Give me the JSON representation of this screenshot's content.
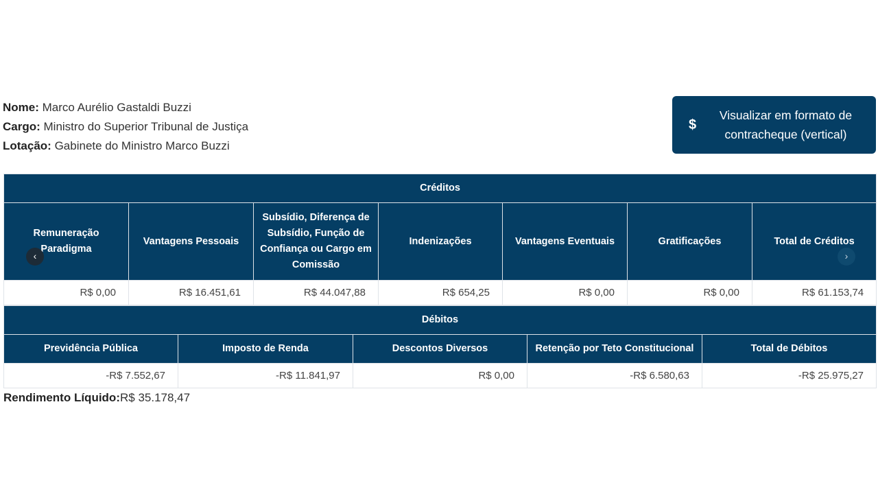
{
  "info": {
    "nome_label": "Nome:",
    "nome_value": "Marco Aurélio Gastaldi Buzzi",
    "cargo_label": "Cargo:",
    "cargo_value": "Ministro do Superior Tribunal de Justiça",
    "lotacao_label": "Lotação:",
    "lotacao_value": "Gabinete do Ministro Marco Buzzi"
  },
  "view_button": {
    "icon": "$",
    "icon_name": "dollar-icon",
    "label": "Visualizar em formato de contracheque (vertical)"
  },
  "creditos": {
    "title": "Créditos",
    "columns": [
      "Remuneração Paradigma",
      "Vantagens Pessoais",
      "Subsídio, Diferença de Subsídio, Função de Confiança ou Cargo em Comissão",
      "Indenizações",
      "Vantagens Eventuais",
      "Gratificações",
      "Total de Créditos"
    ],
    "values": [
      "R$ 0,00",
      "R$ 16.451,61",
      "R$ 44.047,88",
      "R$ 654,25",
      "R$ 0,00",
      "R$ 0,00",
      "R$ 61.153,74"
    ]
  },
  "debitos": {
    "title": "Débitos",
    "columns": [
      "Previdência Pública",
      "Imposto de Renda",
      "Descontos Diversos",
      "Retenção por Teto Constitucional",
      "Total de Débitos"
    ],
    "values": [
      "-R$ 7.552,67",
      "-R$ 11.841,97",
      "R$ 0,00",
      "-R$ 6.580,63",
      "-R$ 25.975,27"
    ]
  },
  "carousel": {
    "prev": "‹",
    "next": "›"
  },
  "net": {
    "label": "Rendimento Líquido:",
    "value": "R$ 35.178,47"
  },
  "colors": {
    "header_bg": "#053e64",
    "border": "#dfe3e8"
  }
}
